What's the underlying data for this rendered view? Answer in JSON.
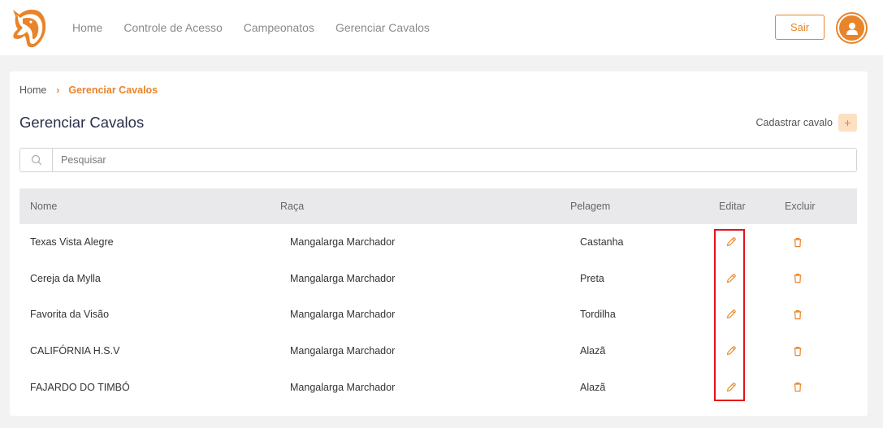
{
  "nav": {
    "items": [
      {
        "label": "Home"
      },
      {
        "label": "Controle de Acesso"
      },
      {
        "label": "Campeonatos"
      },
      {
        "label": "Gerenciar Cavalos"
      }
    ],
    "logout_label": "Sair"
  },
  "icons": {
    "logo": "horse-head-logo",
    "avatar": "user-icon",
    "search": "search-icon",
    "add": "plus-icon",
    "edit": "pencil-icon",
    "delete": "trash-icon"
  },
  "colors": {
    "accent": "#e8842a",
    "accent_light": "#fde0c2",
    "highlight": "#e8101a",
    "title": "#2c2f4a"
  },
  "breadcrumb": {
    "home": "Home",
    "separator": "›",
    "current": "Gerenciar Cavalos"
  },
  "page": {
    "title": "Gerenciar Cavalos",
    "add_label": "Cadastrar cavalo",
    "add_symbol": "+"
  },
  "search": {
    "placeholder": "Pesquisar",
    "value": ""
  },
  "table": {
    "headers": {
      "nome": "Nome",
      "raca": "Raça",
      "pelagem": "Pelagem",
      "editar": "Editar",
      "excluir": "Excluir"
    },
    "rows": [
      {
        "nome": "Texas Vista Alegre",
        "raca": "Mangalarga Marchador",
        "pelagem": "Castanha"
      },
      {
        "nome": "Cereja da Mylla",
        "raca": "Mangalarga Marchador",
        "pelagem": "Preta"
      },
      {
        "nome": "Favorita da Visão",
        "raca": "Mangalarga Marchador",
        "pelagem": "Tordilha"
      },
      {
        "nome": "CALIFÓRNIA H.S.V",
        "raca": "Mangalarga Marchador",
        "pelagem": "Alazã"
      },
      {
        "nome": "FAJARDO DO TIMBÓ",
        "raca": "Mangalarga Marchador",
        "pelagem": "Alazã"
      }
    ]
  }
}
